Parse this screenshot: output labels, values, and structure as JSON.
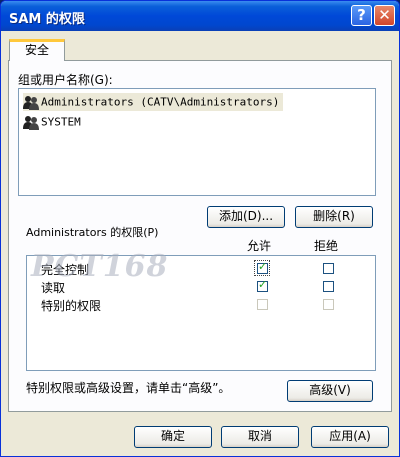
{
  "window": {
    "title": "SAM 的权限"
  },
  "titlebar": {
    "help_glyph": "?",
    "close_glyph": "✕"
  },
  "tabs": [
    {
      "label": "安全"
    }
  ],
  "groups": {
    "label": "组或用户名称(G):",
    "items": [
      {
        "name": "Administrators (CATV\\Administrators)",
        "icon": "users-icon",
        "selected": true
      },
      {
        "name": "SYSTEM",
        "icon": "users-icon",
        "selected": false
      }
    ],
    "add_label": "添加(D)...",
    "remove_label": "删除(R)"
  },
  "permissions": {
    "label": "Administrators 的权限(P)",
    "col_allow": "允许",
    "col_deny": "拒绝",
    "rows": [
      {
        "name": "完全控制",
        "allow": true,
        "deny": false,
        "disabled": false
      },
      {
        "name": "读取",
        "allow": true,
        "deny": false,
        "disabled": false
      },
      {
        "name": "特别的权限",
        "allow": false,
        "deny": false,
        "disabled": true
      }
    ]
  },
  "advanced": {
    "text": "特别权限或高级设置，请单击“高级”。",
    "button_label": "高级(V)"
  },
  "footer": {
    "ok": "确定",
    "cancel": "取消",
    "apply": "应用(A)"
  },
  "watermark": "PCT168"
}
